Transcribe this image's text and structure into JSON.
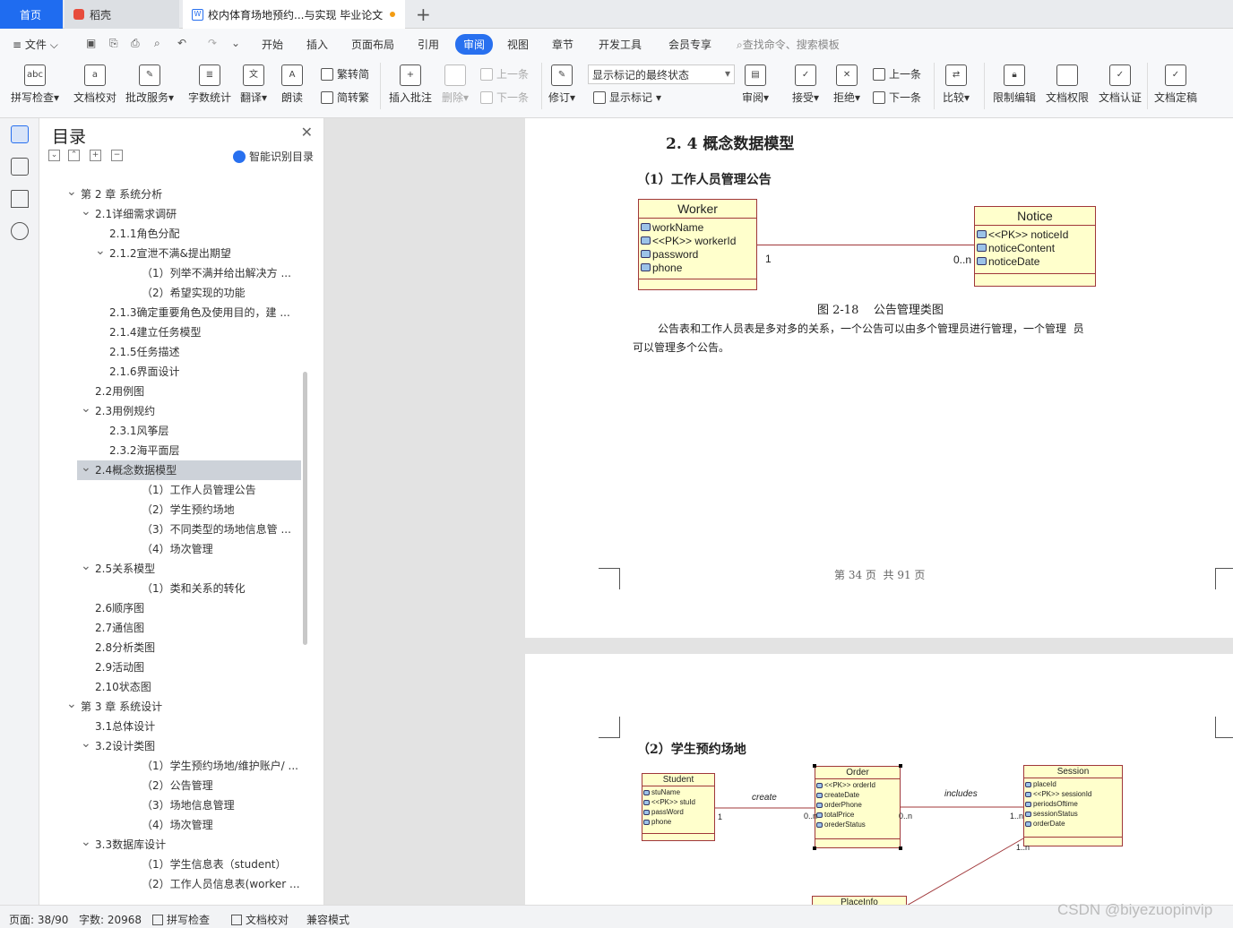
{
  "tabs": {
    "home": "首页",
    "daoke": "稻壳",
    "doc": "校内体育场地预约...与实现 毕业论文"
  },
  "menu": {
    "file": "文件",
    "items": [
      "开始",
      "插入",
      "页面布局",
      "引用",
      "审阅",
      "视图",
      "章节",
      "开发工具",
      "会员专享"
    ],
    "search": "查找命令、搜索模板"
  },
  "ribbon": {
    "spell_check": "拼写检查",
    "doc_proof": "文档校对",
    "revise_service": "批改服务",
    "word_count": "字数统计",
    "translate": "翻译",
    "read_aloud": "朗读",
    "trad_to_simp": "繁转简",
    "simp_to_trad": "简转繁",
    "insert_comment": "插入批注",
    "delete": "删除",
    "prev_comment": "上一条",
    "next_comment": "下一条",
    "track_changes": "修订",
    "markup_mode": "显示标记的最终状态",
    "show_markup": "显示标记",
    "review": "审阅",
    "accept": "接受",
    "reject": "拒绝",
    "prev_change": "上一条",
    "next_change": "下一条",
    "compare": "比较",
    "restrict_edit": "限制编辑",
    "doc_permission": "文档权限",
    "doc_certify": "文档认证",
    "doc_finalize": "文档定稿"
  },
  "toc": {
    "title": "目录",
    "smart": "智能识别目录",
    "items": [
      {
        "level": 1,
        "text": "第 2 章 系统分析",
        "chev": "v"
      },
      {
        "level": 2,
        "text": "2.1详细需求调研",
        "chev": "v"
      },
      {
        "level": 3,
        "text": "2.1.1角色分配"
      },
      {
        "level": 2.5,
        "text": "2.1.2宣泄不满&提出期望",
        "chev": "v"
      },
      {
        "level": 4,
        "text": "（1）列举不满并给出解决方 ..."
      },
      {
        "level": 4,
        "text": "（2）希望实现的功能"
      },
      {
        "level": 3,
        "text": "2.1.3确定重要角色及使用目的，建 ..."
      },
      {
        "level": 3,
        "text": "2.1.4建立任务模型"
      },
      {
        "level": 3,
        "text": "2.1.5任务描述"
      },
      {
        "level": 3,
        "text": "2.1.6界面设计"
      },
      {
        "level": 2,
        "text": "2.2用例图"
      },
      {
        "level": 2,
        "text": "2.3用例规约",
        "chev": "v"
      },
      {
        "level": 3,
        "text": "2.3.1风筝层"
      },
      {
        "level": 3,
        "text": "2.3.2海平面层"
      },
      {
        "level": 2,
        "text": "2.4概念数据模型",
        "chev": "v",
        "selected": true
      },
      {
        "level": 4,
        "text": "（1）工作人员管理公告"
      },
      {
        "level": 4,
        "text": "（2）学生预约场地"
      },
      {
        "level": 4,
        "text": "（3）不同类型的场地信息管 ..."
      },
      {
        "level": 4,
        "text": "（4）场次管理"
      },
      {
        "level": 2,
        "text": "2.5关系模型",
        "chev": "v"
      },
      {
        "level": 4,
        "text": "（1）类和关系的转化"
      },
      {
        "level": 2,
        "text": "2.6顺序图"
      },
      {
        "level": 2,
        "text": "2.7通信图"
      },
      {
        "level": 2,
        "text": "2.8分析类图"
      },
      {
        "level": 2,
        "text": "2.9活动图"
      },
      {
        "level": 2,
        "text": "2.10状态图"
      },
      {
        "level": 1,
        "text": "第 3 章 系统设计",
        "chev": "v"
      },
      {
        "level": 2,
        "text": "3.1总体设计"
      },
      {
        "level": 2,
        "text": "3.2设计类图",
        "chev": "v"
      },
      {
        "level": 4,
        "text": "（1）学生预约场地/维护账户/ ..."
      },
      {
        "level": 4,
        "text": "（2）公告管理"
      },
      {
        "level": 4,
        "text": "（3）场地信息管理"
      },
      {
        "level": 4,
        "text": "（4）场次管理"
      },
      {
        "level": 2,
        "text": "3.3数据库设计",
        "chev": "v"
      },
      {
        "level": 4,
        "text": "（1）学生信息表（student）"
      },
      {
        "level": 4,
        "text": "（2）工作人员信息表(worker ..."
      }
    ]
  },
  "doc": {
    "section_heading": "2. 4 概念数据模型",
    "sub1": "（1）工作人员管理公告",
    "worker": {
      "name": "Worker",
      "attrs": [
        "workName",
        "<<PK>> workerId",
        "password",
        "phone"
      ]
    },
    "notice": {
      "name": "Notice",
      "attrs": [
        "<<PK>> noticeId",
        "noticeContent",
        "noticeDate"
      ]
    },
    "mult_left": "1",
    "mult_right": "0..n",
    "caption": "图 2-18    公告管理类图",
    "para_line1": "公告表和工作人员表是多对多的关系，一个公告可以由多个管理员进行管理，一个管理  员",
    "para_line2": "可以管理多个公告。",
    "footer": "第 34 页  共 91 页",
    "sub2": "（2）学生预约场地",
    "student": {
      "name": "Student",
      "attrs": [
        "stuName",
        "<<PK>> stuId",
        "passWord",
        "phone"
      ]
    },
    "order": {
      "name": "Order",
      "attrs": [
        "<<PK>> orderId",
        "createDate",
        "orderPhone",
        "totalPrice",
        "orederStatus"
      ]
    },
    "session": {
      "name": "Session",
      "attrs": [
        "placeId",
        "<<PK>> sessionId",
        "periodsOftime",
        "sessionStatus",
        "orderDate"
      ]
    },
    "placeinfo": {
      "name": "PlaceInfo"
    },
    "assoc_create": "create",
    "assoc_includes": "includes",
    "m_stu": "1",
    "m_order_l": "0..n",
    "m_order_r": "0..n",
    "m_session": "1..n",
    "m_session_b": "1..n"
  },
  "status": {
    "page": "页面: 38/90",
    "words": "字数: 20968",
    "spell": "拼写检查",
    "proof": "文档校对",
    "compat": "兼容模式"
  },
  "watermark": "CSDN @biyezuopinvip"
}
